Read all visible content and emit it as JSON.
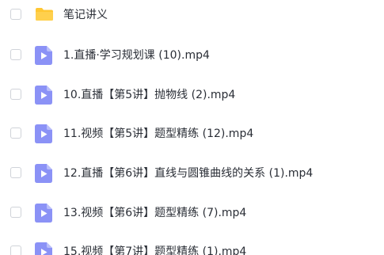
{
  "colors": {
    "folder": "#FFC733",
    "video_icon_bg": "#8B92F6",
    "video_icon_fold": "#B9BEFA",
    "text": "#2A2E36",
    "checkbox_border": "#D0D3D9"
  },
  "files": [
    {
      "icon": "folder-icon",
      "name": "笔记讲义"
    },
    {
      "icon": "video-file-icon",
      "name": "1.直播·学习规划课 (10).mp4"
    },
    {
      "icon": "video-file-icon",
      "name": "10.直播【第5讲】抛物线 (2).mp4"
    },
    {
      "icon": "video-file-icon",
      "name": "11.视频【第5讲】题型精练 (12).mp4"
    },
    {
      "icon": "video-file-icon",
      "name": "12.直播【第6讲】直线与圆锥曲线的关系 (1).mp4"
    },
    {
      "icon": "video-file-icon",
      "name": "13.视频【第6讲】题型精练 (7).mp4"
    },
    {
      "icon": "video-file-icon",
      "name": "15.视频【第7讲】题型精练 (1).mp4"
    }
  ]
}
